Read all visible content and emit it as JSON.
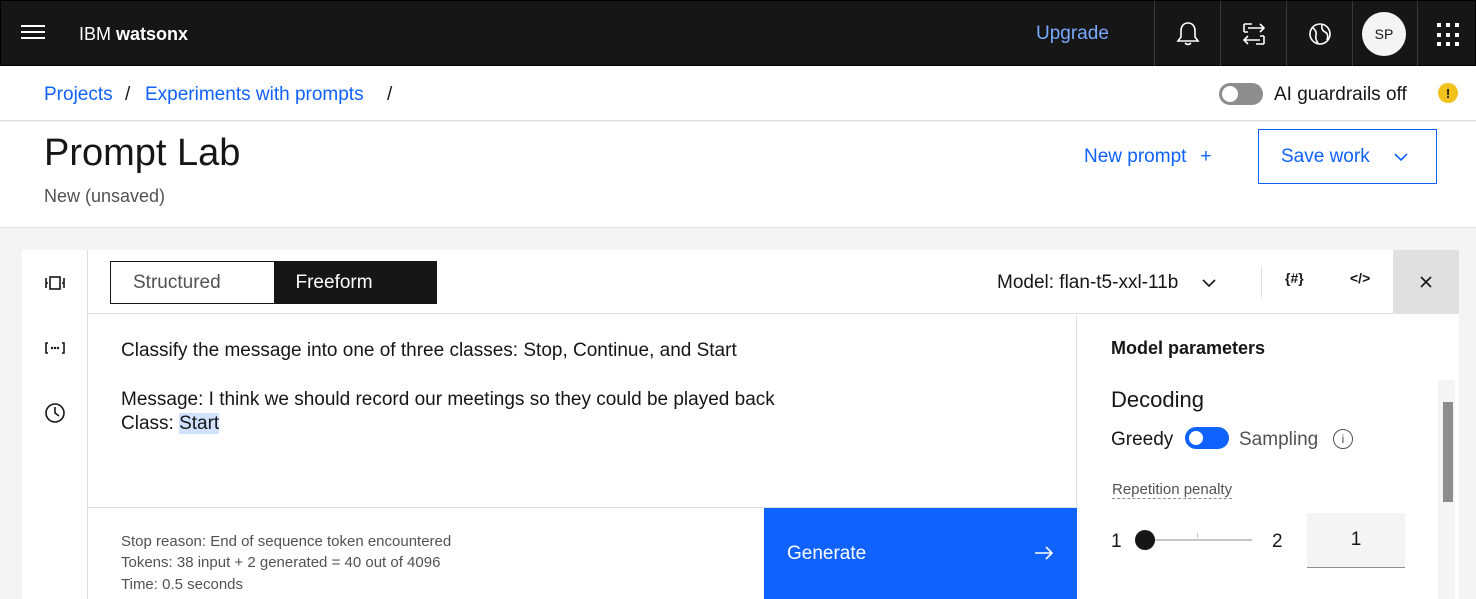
{
  "topbar": {
    "brand_prefix": "IBM",
    "brand_name": "watsonx",
    "upgrade_label": "Upgrade",
    "avatar_initials": "SP"
  },
  "breadcrumb": {
    "items": [
      "Projects",
      "Experiments with prompts"
    ],
    "separator": "/"
  },
  "guardrails": {
    "label": "AI guardrails off",
    "state": "off",
    "warning_glyph": "!"
  },
  "header": {
    "title": "Prompt Lab",
    "subtitle": "New (unsaved)",
    "new_prompt_label": "New prompt",
    "save_work_label": "Save work"
  },
  "toolbar": {
    "modes": [
      "Structured",
      "Freeform"
    ],
    "active_mode": "Freeform",
    "model_label": "Model: flan-t5-xxl-11b",
    "variables_icon_text": "{#}",
    "code_icon_text": "</>"
  },
  "editor": {
    "line1": "Classify the message into one of three classes: Stop, Continue, and Start",
    "line2": "Message: I think we should record our meetings so they could be played back",
    "line3_prefix": "Class: ",
    "line3_generated": "Start"
  },
  "footer": {
    "stop_reason": "Stop reason: End of sequence token encountered",
    "tokens": "Tokens: 38 input + 2 generated = 40 out of 4096",
    "time": "Time: 0.5 seconds",
    "generate_label": "Generate"
  },
  "params": {
    "title": "Model parameters",
    "decoding_label": "Decoding",
    "greedy_label": "Greedy",
    "sampling_label": "Sampling",
    "decoding_mode": "Greedy",
    "repetition_label": "Repetition penalty",
    "slider_min": "1",
    "slider_max": "2",
    "slider_value": "1"
  },
  "colors": {
    "accent": "#0f62fe",
    "topbar": "#161616",
    "warning": "#f1c21b"
  }
}
